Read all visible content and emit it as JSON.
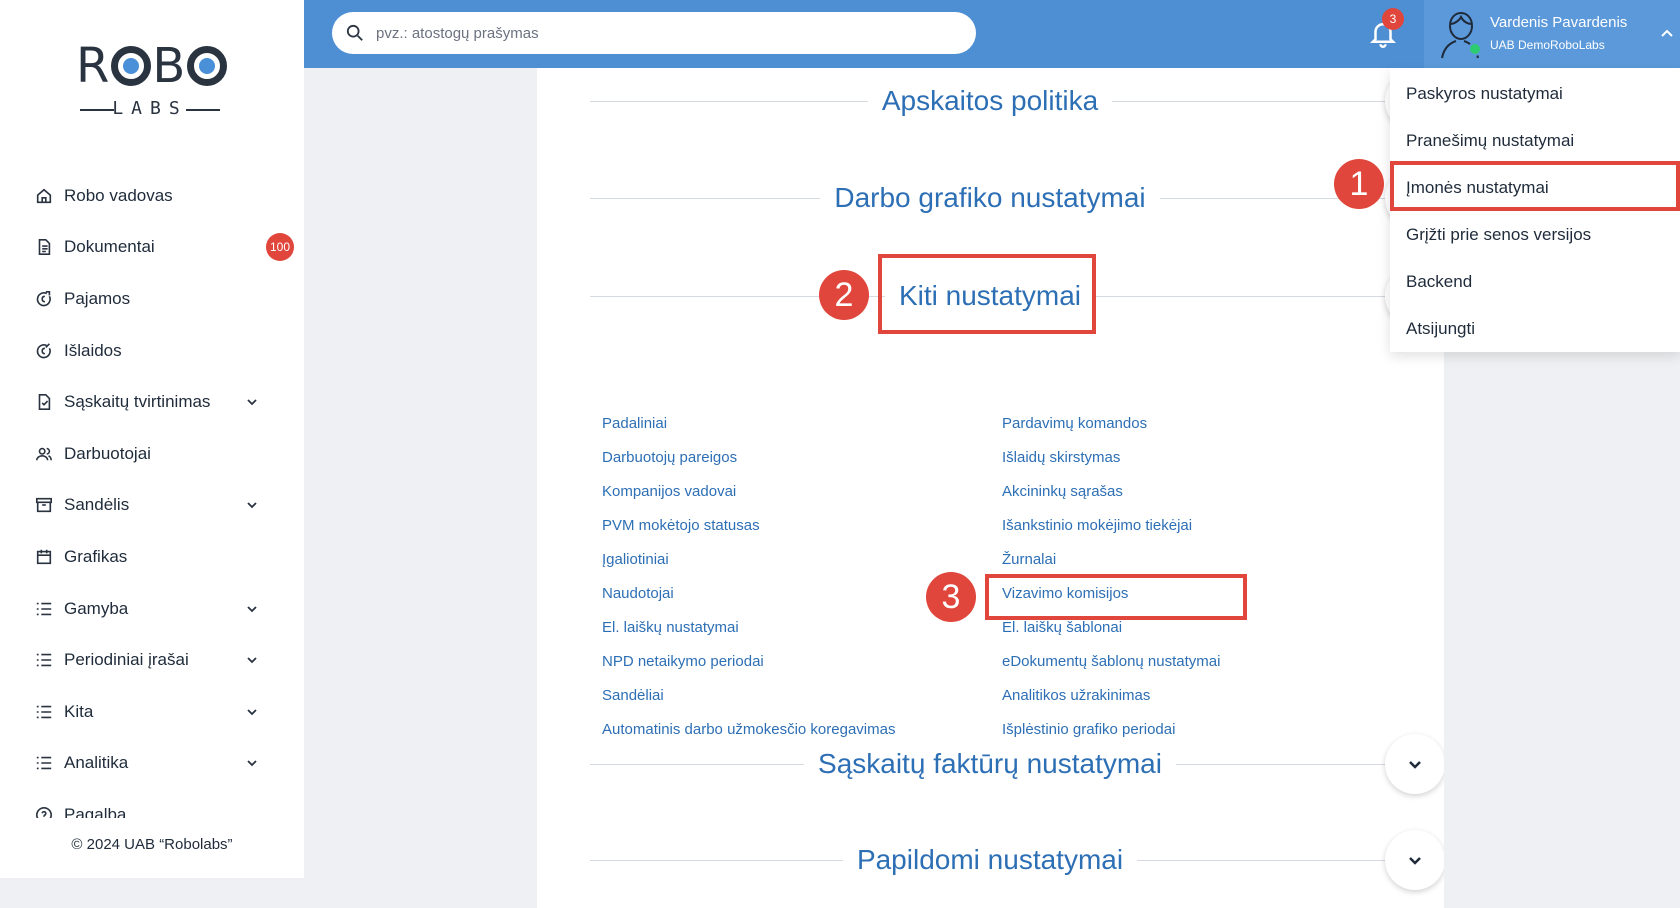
{
  "brand": {
    "logo_text": "ROBO LABS"
  },
  "sidebar": {
    "items": [
      {
        "label": "Robo vadovas",
        "icon": "home-icon"
      },
      {
        "label": "Dokumentai",
        "icon": "document-icon",
        "badge": "100"
      },
      {
        "label": "Pajamos",
        "icon": "income-icon"
      },
      {
        "label": "Išlaidos",
        "icon": "expense-icon"
      },
      {
        "label": "Sąskaitų tvirtinimas",
        "icon": "invoice-check-icon",
        "expandable": true
      },
      {
        "label": "Darbuotojai",
        "icon": "users-icon"
      },
      {
        "label": "Sandėlis",
        "icon": "warehouse-icon",
        "expandable": true
      },
      {
        "label": "Grafikas",
        "icon": "calendar-icon"
      },
      {
        "label": "Gamyba",
        "icon": "list-icon",
        "expandable": true
      },
      {
        "label": "Periodiniai įrašai",
        "icon": "list-icon",
        "expandable": true
      },
      {
        "label": "Kita",
        "icon": "list-icon",
        "expandable": true
      },
      {
        "label": "Analitika",
        "icon": "list-icon",
        "expandable": true
      },
      {
        "label": "Pagalba",
        "icon": "help-icon"
      }
    ],
    "footer": "© 2024 UAB “Robolabs”"
  },
  "topbar": {
    "search_placeholder": "pvz.: atostogų prašymas",
    "notifications_count": "3",
    "user_name": "Vardenis Pavardenis",
    "user_company": "UAB DemoRoboLabs"
  },
  "sections": {
    "apskaitos": "Apskaitos politika",
    "darbo": "Darbo grafiko nustatymai",
    "kiti": "Kiti nustatymai",
    "saskaitu": "Sąskaitų faktūrų nustatymai",
    "papildomi": "Papildomi nustatymai"
  },
  "kiti_links": {
    "left": [
      "Padaliniai",
      "Darbuotojų pareigos",
      "Kompanijos vadovai",
      "PVM mokėtojo statusas",
      "Įgaliotiniai",
      "Naudotojai",
      "El. laiškų nustatymai",
      "NPD netaikymo periodai",
      "Sandėliai",
      "Automatinis darbo užmokesčio koregavimas"
    ],
    "right": [
      "Pardavimų komandos",
      "Išlaidų skirstymas",
      "Akcininkų sąrašas",
      "Išankstinio mokėjimo tiekėjai",
      "Žurnalai",
      "Vizavimo komisijos",
      "El. laiškų šablonai",
      "eDokumentų šablonų nustatymai",
      "Analitikos užrakinimas",
      "Išplėstinio grafiko periodai"
    ]
  },
  "user_menu": {
    "items": [
      "Paskyros nustatymai",
      "Pranešimų nustatymai",
      "Įmonės nustatymai",
      "Grįžti prie senos versijos",
      "Backend",
      "Atsijungti"
    ]
  },
  "annotations": {
    "step1": "1",
    "step2": "2",
    "step3": "3"
  },
  "colors": {
    "topbar": "#4e8fd4",
    "link": "#2d6fb5",
    "highlight": "#e0463b"
  }
}
